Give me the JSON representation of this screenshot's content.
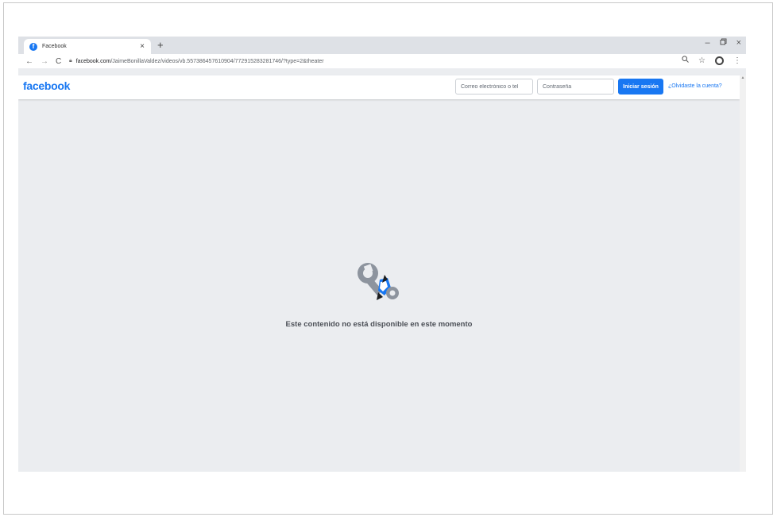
{
  "browser": {
    "tab_title": "Facebook",
    "tab_close": "×",
    "new_tab": "+",
    "window_controls": {
      "minimize": "–",
      "restore": "ᗜ",
      "close": "×"
    },
    "url_host": "facebook.com",
    "url_path": "/JaimeBonillaValdez/videos/vb.557386457610904/772915283281746/?type=2&theater"
  },
  "facebook": {
    "logo": "facebook",
    "email_placeholder": "Correo electrónico o tel",
    "password_placeholder": "Contraseña",
    "login_label": "Iniciar sesión",
    "forgot_label": "¿Olvidaste la cuenta?",
    "message": "Este contenido no está disponible en este momento"
  },
  "icons": [
    "facebook-favicon-icon",
    "back-arrow-icon",
    "forward-arrow-icon",
    "reload-icon",
    "lock-icon",
    "zoom-icon",
    "star-icon",
    "profile-icon",
    "more-icon",
    "broken-wrench-icon"
  ],
  "colors": {
    "brand": "#1877f2",
    "page_bg": "#ebedf0",
    "text": "#4b4f56"
  }
}
